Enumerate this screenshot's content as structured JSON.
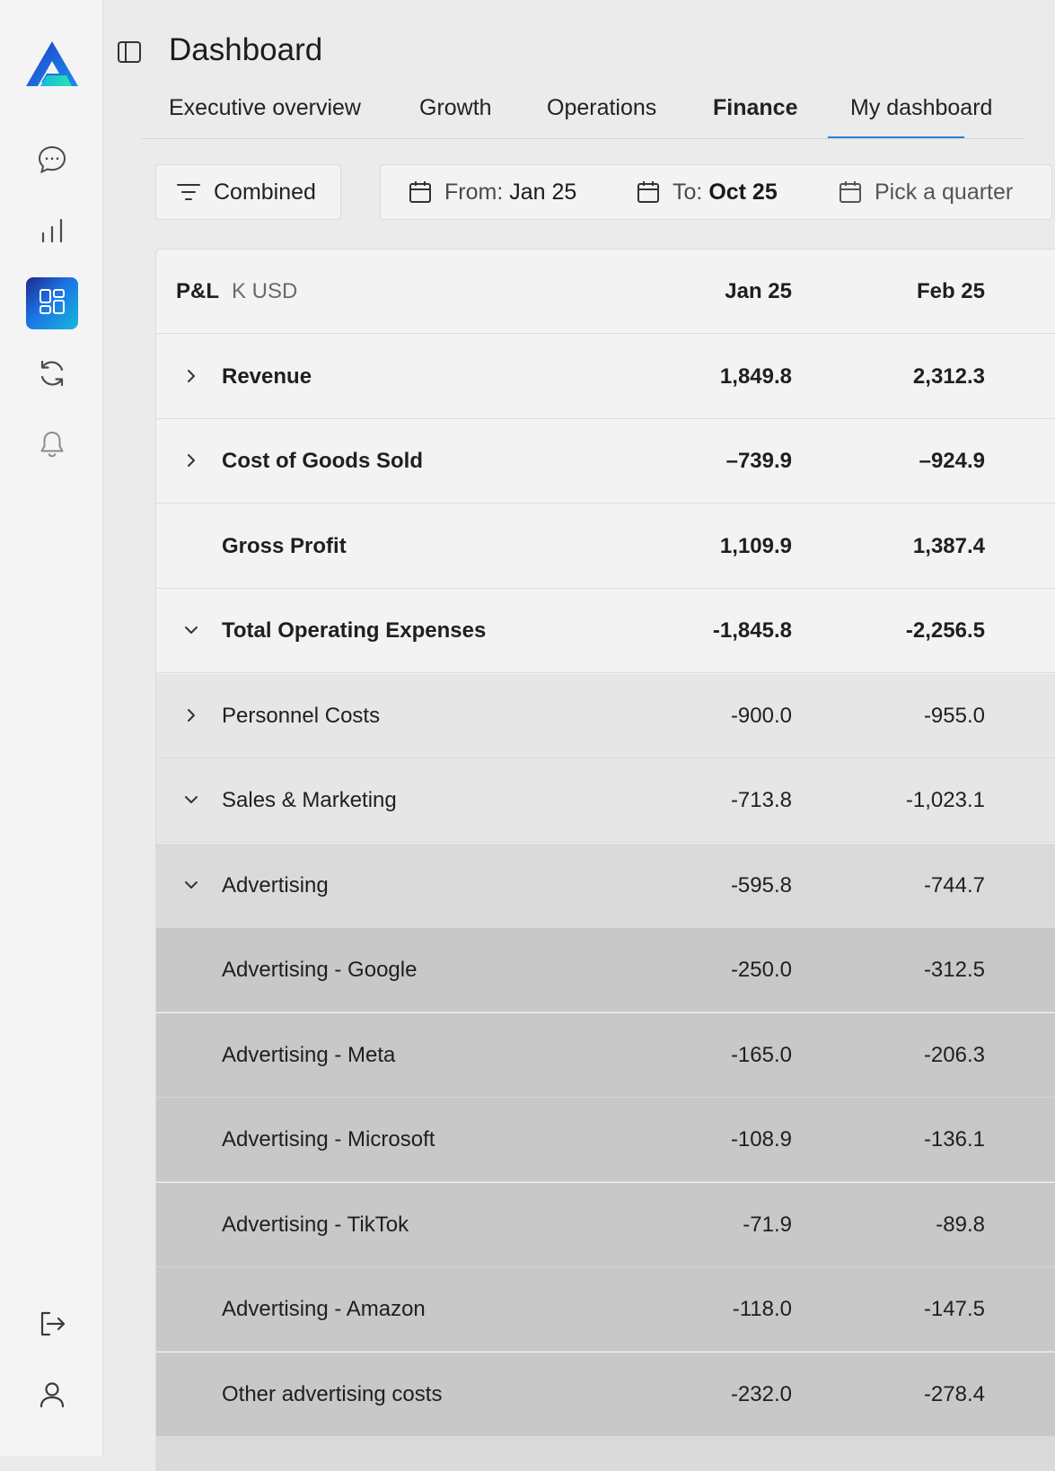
{
  "app": {
    "title": "Dashboard"
  },
  "sidebar": {
    "logo_icon": "app-logo",
    "items": [
      {
        "icon": "chat-icon",
        "active": false
      },
      {
        "icon": "bar-chart-icon",
        "active": false
      },
      {
        "icon": "dashboard-icon",
        "active": true
      },
      {
        "icon": "sync-icon",
        "active": false
      },
      {
        "icon": "bell-icon",
        "active": false
      }
    ],
    "bottom_items": [
      {
        "icon": "logout-icon"
      },
      {
        "icon": "user-icon"
      }
    ]
  },
  "tabs": [
    {
      "label": "Executive overview",
      "active": false
    },
    {
      "label": "Growth",
      "active": false
    },
    {
      "label": "Operations",
      "active": false
    },
    {
      "label": "Finance",
      "active": true
    },
    {
      "label": "My dashboard",
      "active": false
    }
  ],
  "filters": {
    "view": "Combined",
    "from_label": "From:",
    "from_value": "Jan 25",
    "to_label": "To:",
    "to_value": "Oct 25",
    "quarter_placeholder": "Pick a quarter"
  },
  "table": {
    "title": "P&L",
    "unit": "K USD",
    "columns": [
      "Jan 25",
      "Feb 25"
    ],
    "rows": [
      {
        "label": "Revenue",
        "expand": "collapsed",
        "level": 1,
        "bold": true,
        "values": [
          "1,849.8",
          "2,312.3"
        ]
      },
      {
        "label": "Cost of Goods Sold",
        "expand": "collapsed",
        "level": 1,
        "bold": true,
        "values": [
          "–739.9",
          "–924.9"
        ]
      },
      {
        "label": "Gross Profit",
        "expand": "none",
        "level": 1,
        "bold": true,
        "values": [
          "1,109.9",
          "1,387.4"
        ]
      },
      {
        "label": "Total Operating Expenses",
        "expand": "expanded",
        "level": 1,
        "bold": true,
        "values": [
          "-1,845.8",
          "-2,256.5"
        ]
      },
      {
        "label": "Personnel Costs",
        "expand": "collapsed",
        "level": 2,
        "bold": false,
        "values": [
          "-900.0",
          "-955.0"
        ]
      },
      {
        "label": "Sales & Marketing",
        "expand": "expanded",
        "level": 2,
        "bold": false,
        "values": [
          "-713.8",
          "-1,023.1"
        ]
      },
      {
        "label": "Advertising",
        "expand": "expanded",
        "level": 3,
        "bold": false,
        "values": [
          "-595.8",
          "-744.7"
        ]
      },
      {
        "label": "Advertising - Google",
        "expand": "none",
        "level": 4,
        "bold": false,
        "values": [
          "-250.0",
          "-312.5"
        ]
      },
      {
        "label": "Advertising - Meta",
        "expand": "none",
        "level": 4,
        "bold": false,
        "values": [
          "-165.0",
          "-206.3"
        ]
      },
      {
        "label": "Advertising - Microsoft",
        "expand": "none",
        "level": 4,
        "bold": false,
        "values": [
          "-108.9",
          "-136.1"
        ]
      },
      {
        "label": "Advertising - TikTok",
        "expand": "none",
        "level": 4,
        "bold": false,
        "values": [
          "-71.9",
          "-89.8"
        ]
      },
      {
        "label": "Advertising - Amazon",
        "expand": "none",
        "level": 4,
        "bold": false,
        "values": [
          "-118.0",
          "-147.5"
        ]
      },
      {
        "label": "Other advertising costs",
        "expand": "none",
        "level": 4,
        "bold": false,
        "values": [
          "-232.0",
          "-278.4"
        ]
      }
    ]
  },
  "colors": {
    "accent": "#2d7fd3",
    "logo_blue": "#1565d8",
    "logo_teal": "#22d3b6"
  }
}
